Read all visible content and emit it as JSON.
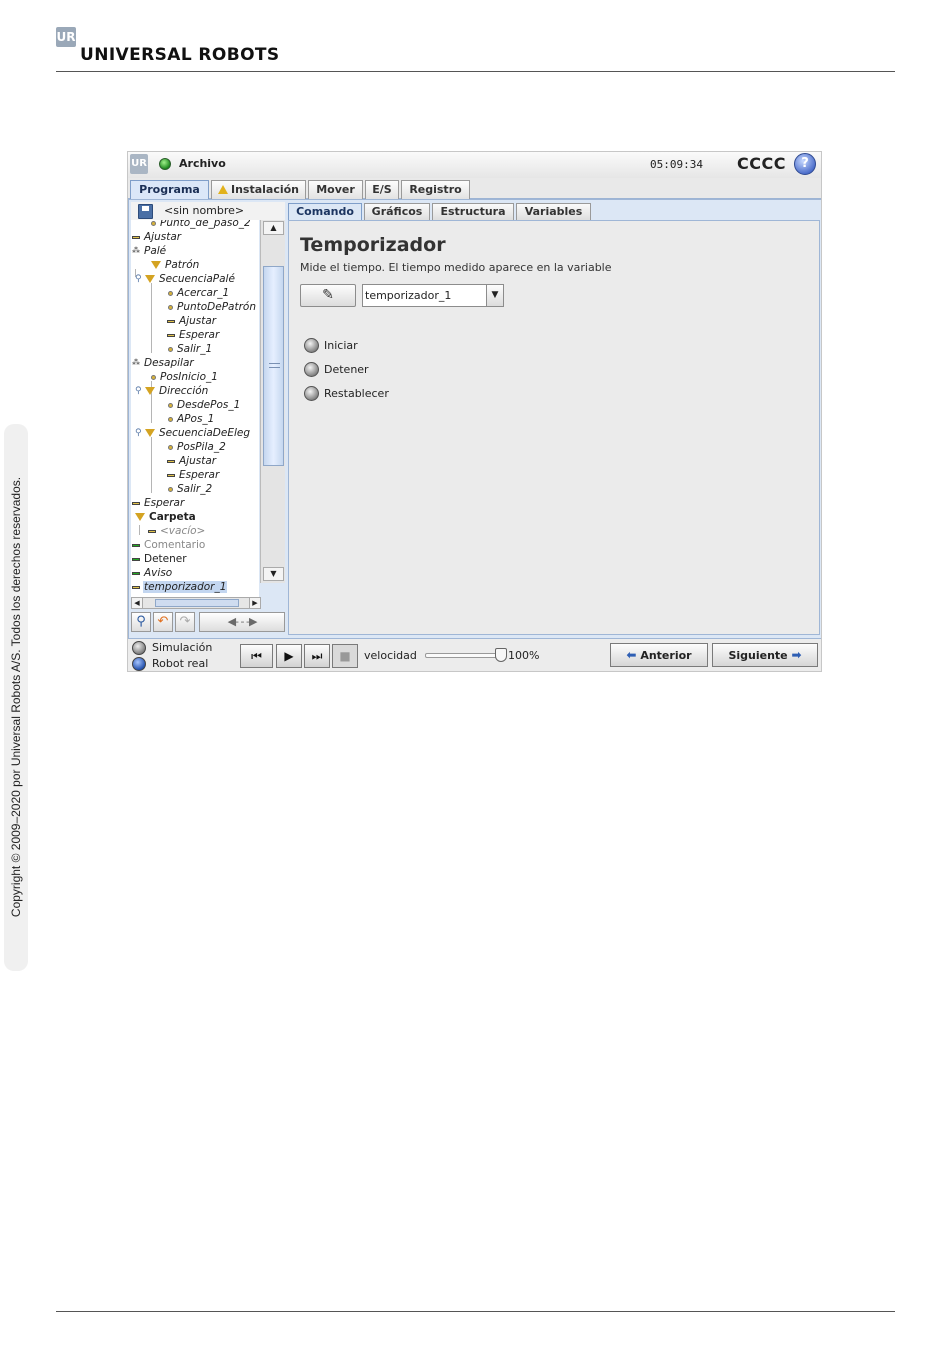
{
  "page": {
    "brand": "UNIVERSAL ROBOTS",
    "logo_mark": "UR",
    "copyright": "Copyright © 2009–2020 por Universal Robots A/S. Todos los derechos reservados."
  },
  "titlebar": {
    "logo_mark": "UR",
    "file_menu": "Archivo",
    "clock": "05:09:34",
    "robot_name": "CCCC",
    "help_label": "?"
  },
  "main_tabs": [
    {
      "label": "Programa",
      "active": true
    },
    {
      "label": "Instalación",
      "icon": "warning-icon"
    },
    {
      "label": "Mover"
    },
    {
      "label": "E/S"
    },
    {
      "label": "Registro"
    }
  ],
  "program": {
    "name": "<sin nombre>",
    "tree": [
      {
        "label": "Punto_de_paso_2",
        "icon": "waypoint-icon"
      },
      {
        "label": "Ajustar",
        "icon": "bar-icon"
      },
      {
        "label": "Palé",
        "icon": "pallet-icon"
      },
      {
        "label": "Patrón",
        "icon": "folder-triangle-icon"
      },
      {
        "label": "SecuenciaPalé",
        "icon": "folder-triangle-icon"
      },
      {
        "label": "Acercar_1",
        "icon": "waypoint-icon"
      },
      {
        "label": "PuntoDePatrón",
        "icon": "waypoint-icon"
      },
      {
        "label": "Ajustar",
        "icon": "bar-icon"
      },
      {
        "label": "Esperar",
        "icon": "bar-icon"
      },
      {
        "label": "Salir_1",
        "icon": "waypoint-icon"
      },
      {
        "label": "Desapilar",
        "icon": "pallet-icon"
      },
      {
        "label": "PosInicio_1",
        "icon": "waypoint-icon"
      },
      {
        "label": "Dirección",
        "icon": "folder-triangle-icon"
      },
      {
        "label": "DesdePos_1",
        "icon": "waypoint-icon"
      },
      {
        "label": "APos_1",
        "icon": "waypoint-icon"
      },
      {
        "label": "SecuenciaDeEleg",
        "icon": "folder-triangle-icon"
      },
      {
        "label": "PosPila_2",
        "icon": "waypoint-icon"
      },
      {
        "label": "Ajustar",
        "icon": "bar-icon"
      },
      {
        "label": "Esperar",
        "icon": "bar-icon"
      },
      {
        "label": "Salir_2",
        "icon": "waypoint-icon"
      },
      {
        "label": "Esperar",
        "icon": "bar-icon"
      },
      {
        "label": "Carpeta",
        "icon": "folder-triangle-icon"
      },
      {
        "label": "<vacío>",
        "icon": "bar-icon"
      },
      {
        "label": "Comentario",
        "icon": "bar-icon"
      },
      {
        "label": "Detener",
        "icon": "bar-icon"
      },
      {
        "label": "Aviso",
        "icon": "bar-icon"
      },
      {
        "label": "temporizador_1",
        "icon": "bar-icon",
        "selected": true
      }
    ]
  },
  "sub_tabs": [
    {
      "label": "Comando",
      "active": true
    },
    {
      "label": "Gráficos"
    },
    {
      "label": "Estructura"
    },
    {
      "label": "Variables"
    }
  ],
  "command": {
    "title": "Temporizador",
    "description": "Mide el tiempo. El tiempo medido aparece en la variable",
    "variable": "temporizador_1",
    "options": [
      "Iniciar",
      "Detener",
      "Restablecer"
    ]
  },
  "bottom": {
    "mode_simulation": "Simulación",
    "mode_real": "Robot real",
    "speed_label": "velocidad",
    "speed_value": "100%",
    "speed_fraction": 1.0,
    "prev_label": "Anterior",
    "next_label": "Siguiente"
  },
  "colors": {
    "accent": "#dce7f5",
    "status_ok": "#1f8a1f",
    "warning": "#e2b21c"
  }
}
